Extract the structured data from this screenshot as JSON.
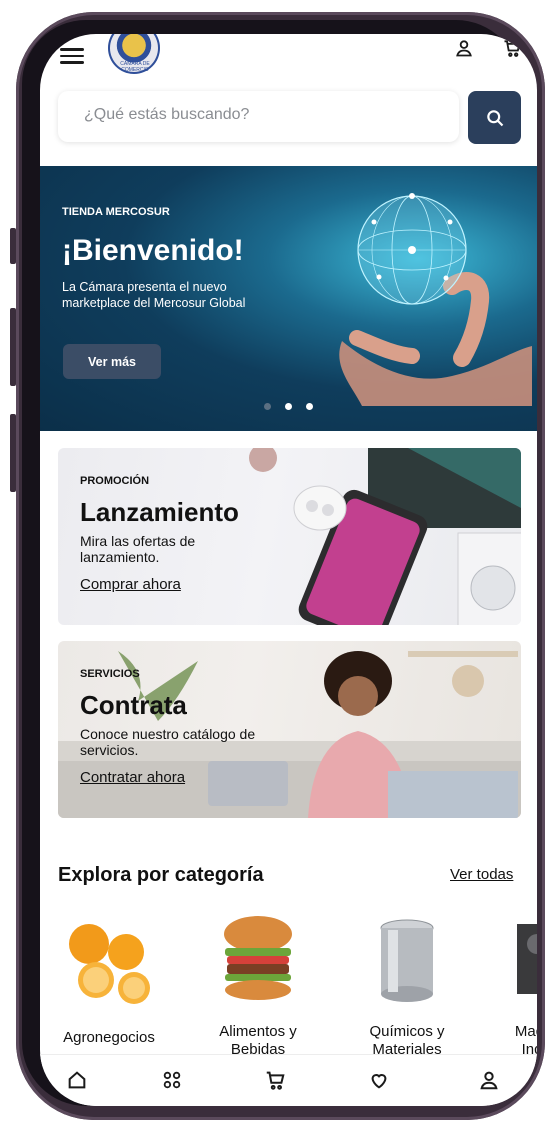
{
  "header": {
    "logo_caption": "CÁMARA DE COMERCIO",
    "menu_icon": "hamburger-menu-icon",
    "account_icon": "user-icon",
    "cart_icon": "cart-icon"
  },
  "search": {
    "placeholder": "¿Qué estás buscando?",
    "button_icon": "search-icon"
  },
  "hero": {
    "brand": "TIENDA MERCOSUR",
    "title": "¡Bienvenido!",
    "description": "La Cámara presenta el nuevo marketplace del Mercosur Global",
    "button_label": "Ver más",
    "slide_count": 3,
    "active_slide": 2
  },
  "promo": {
    "tag": "PROMOCIÓN",
    "title": "Lanzamiento",
    "description": "Mira las ofertas de lanzamiento.",
    "link": "Comprar ahora"
  },
  "services": {
    "tag": "SERVICIOS",
    "title": "Contrata",
    "description": "Conoce nuestro catálogo de servicios.",
    "link": "Contratar ahora"
  },
  "categories": {
    "title": "Explora por categoría",
    "view_all": "Ver todas",
    "items": [
      {
        "label": "Agronegocios"
      },
      {
        "label": "Alimentos y Bebidas"
      },
      {
        "label": "Químicos y Materiales"
      },
      {
        "label": "Maquinaria Industrial"
      }
    ]
  },
  "bottom_nav": {
    "items": [
      "home-icon",
      "grid-icon",
      "cart-icon",
      "heart-icon",
      "user-icon"
    ]
  },
  "colors": {
    "accent": "#2b3f5c",
    "hero_button": "#3b4d66"
  }
}
